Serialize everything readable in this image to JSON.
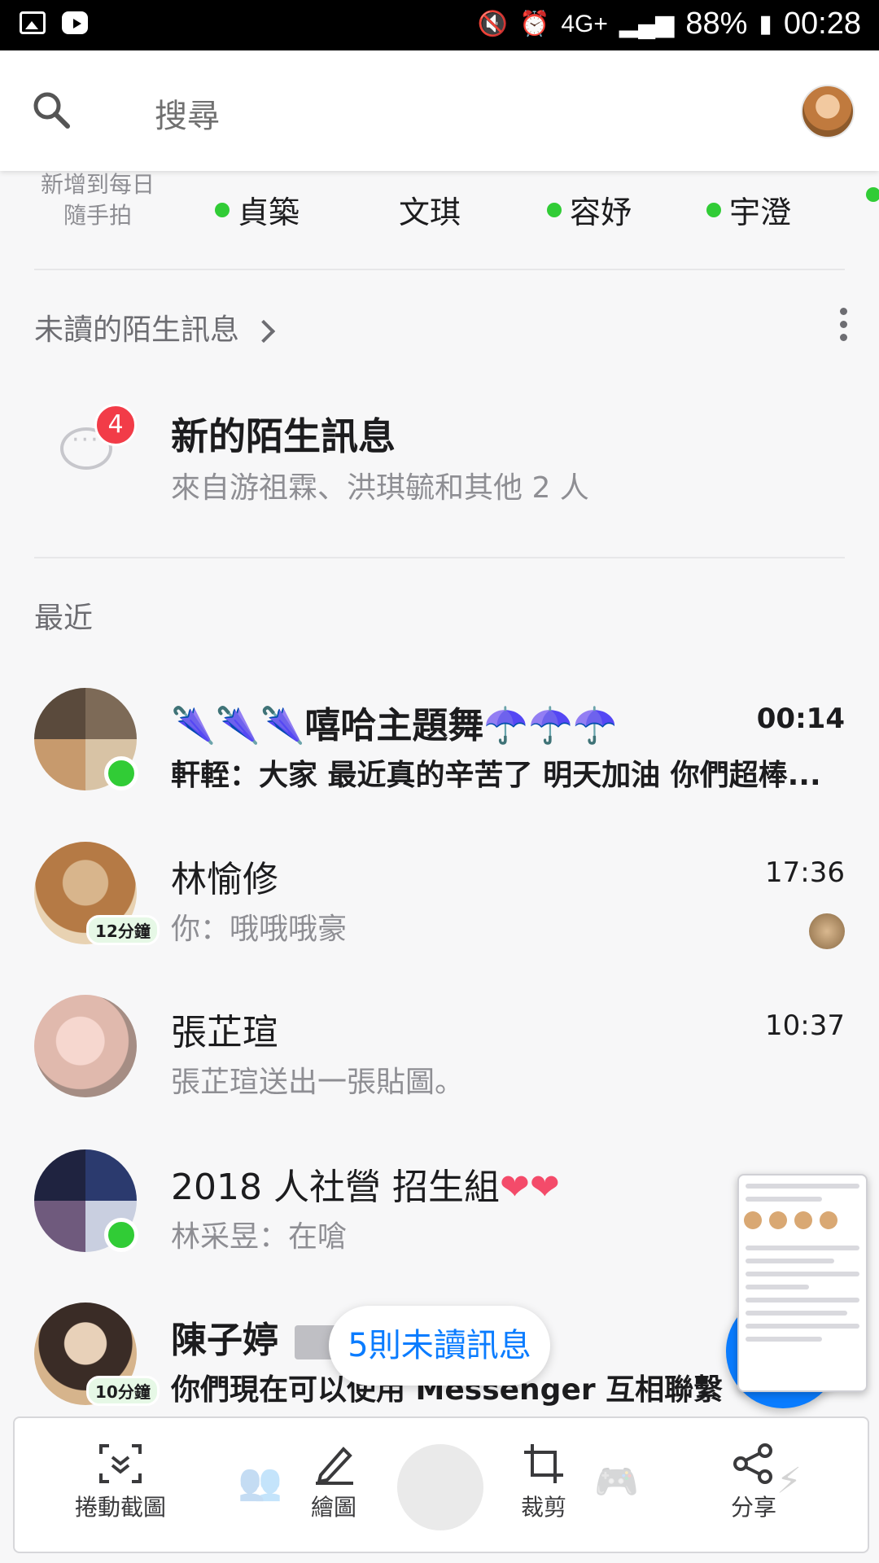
{
  "status_bar": {
    "network": "4G+",
    "battery": "88%",
    "time": "00:28"
  },
  "search": {
    "placeholder": "搜尋"
  },
  "active_now": {
    "add_daily": "新增到每日隨手拍",
    "people": [
      {
        "name": "貞築",
        "online": true
      },
      {
        "name": "文琪",
        "online": false
      },
      {
        "name": "容妤",
        "online": true
      },
      {
        "name": "宇澄",
        "online": true
      }
    ]
  },
  "message_requests": {
    "header": "未讀的陌生訊息",
    "title": "新的陌生訊息",
    "subtitle": "來自游祖霖、洪琪毓和其他 2 人",
    "badge": "4"
  },
  "recent": {
    "header": "最近",
    "conversations": [
      {
        "name": "🌂🌂🌂嘻哈主題舞☂️☂️☂️",
        "time": "00:14",
        "preview": "軒輊：大家 最近真的辛苦了 明天加油 你們超棒...",
        "unread": true
      },
      {
        "name": "林愉修",
        "time": "17:36",
        "preview": "你：哦哦哦豪",
        "active_ago": "12分鐘"
      },
      {
        "name": "張芷瑄",
        "time": "10:37",
        "preview": "張芷瑄送出一張貼圖。"
      },
      {
        "name": "2018 人社營 招生組",
        "hearts": "❤❤",
        "preview": "林采昱：在嗆"
      },
      {
        "name": "陳子婷",
        "preview": "你們現在可以使用 Messenger 互相聯繫",
        "active_ago": "10分鐘",
        "unread": true
      }
    ]
  },
  "unread_pill": "5則未讀訊息",
  "screenshot_toolbar": {
    "scroll_capture": "捲動截圖",
    "draw": "繪圖",
    "crop": "裁剪",
    "share": "分享"
  },
  "colors": {
    "online": "#31cc36",
    "accent": "#0a7cff",
    "badge": "#f23c48"
  }
}
